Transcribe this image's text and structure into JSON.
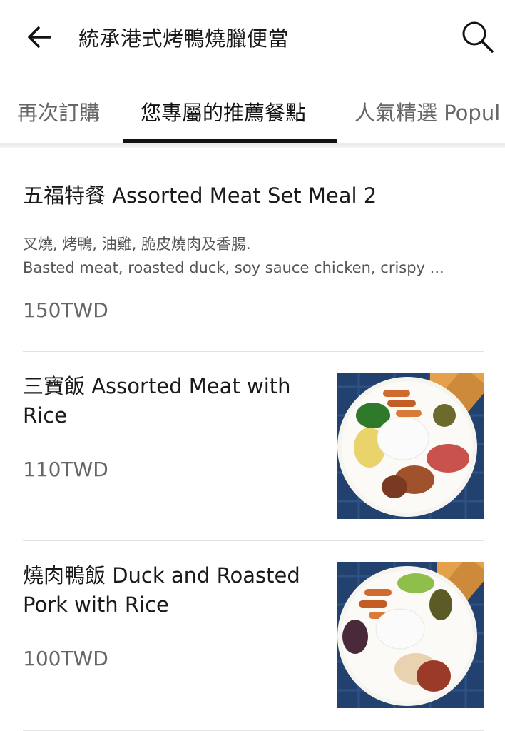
{
  "header": {
    "title": "統承港式烤鴨燒臘便當"
  },
  "tabs": [
    {
      "label": "再次訂購",
      "active": false
    },
    {
      "label": "您專屬的推薦餐點",
      "active": true
    },
    {
      "label": "人氣精選 Popul",
      "active": false
    }
  ],
  "menu": {
    "items": [
      {
        "name": "五福特餐 Assorted Meat Set Meal 2",
        "desc_line1": "叉燒, 烤鴨, 油雞, 脆皮燒肉及香腸.",
        "desc_line2": "Basted meat, roasted duck, soy sauce chicken, crispy ...",
        "price": "150TWD"
      },
      {
        "name_line1": "三寶飯 Assorted Meat with",
        "name_line2": "Rice",
        "price": "110TWD"
      },
      {
        "name_line1": "燒肉鴨飯 Duck and Roasted",
        "name_line2": "Pork with Rice",
        "price": "100TWD"
      }
    ]
  },
  "colors": {
    "text_primary": "#1a1a1a",
    "text_secondary": "#666666",
    "tab_active_underline": "#111111",
    "divider": "#e2e2e2",
    "tablecloth": "#23416e"
  },
  "icons": {
    "back": "arrow-left-icon",
    "search": "magnifier-icon"
  }
}
